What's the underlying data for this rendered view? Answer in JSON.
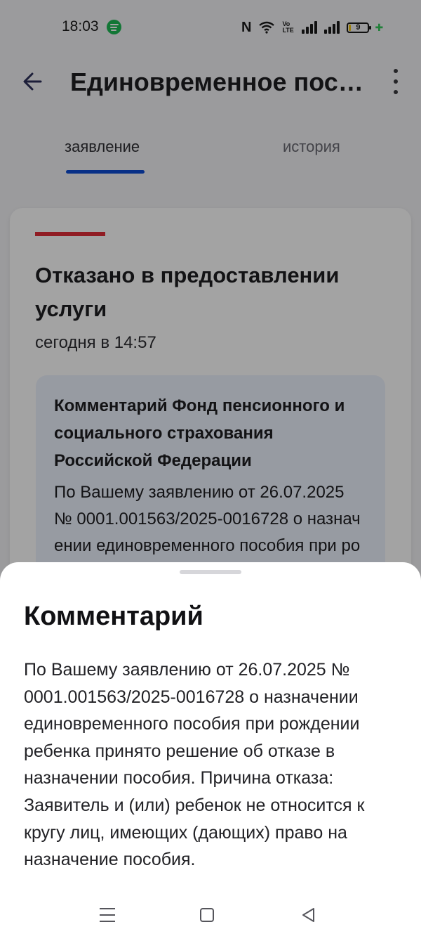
{
  "status_bar": {
    "time": "18:03",
    "nfc_label": "N",
    "volte_label": "Vo LTE",
    "battery_level": "9"
  },
  "header": {
    "title": "Единовременное пособие при рождении ребенка"
  },
  "tabs": [
    {
      "label": "заявление",
      "active": true
    },
    {
      "label": "история",
      "active": false
    }
  ],
  "status_card": {
    "title": "Отказано в предоставлении услуги",
    "time": "сегодня в 14:57",
    "comment_heading": "Комментарий Фонд пенсионного и социального страхования Российской Федерации",
    "comment_text": "По Вашему заявлению от 26.07.2025 № 0001.001563/2025-0016728 о назначении единовременного пособия при рождении ребенка принято решение об отказе в назначении пособия."
  },
  "sheet": {
    "title": "Комментарий",
    "text": "По Вашему заявлению от 26.07.2025 № 0001.001563/2025-0016728 о назначении единовременного пособия при рождении ребенка принято решение об отказе в назначении пособия. Причина отказа: Заявитель и (или) ребенок не относится к кругу лиц, имеющих (дающих) право на назначение пособия."
  },
  "colors": {
    "accent_blue": "#0d4cd3",
    "status_red": "#e22c38",
    "comment_bg": "#edf2fe",
    "scrim": "rgba(0,0,0,0.36)"
  },
  "icons": {
    "back": "arrow-left-icon",
    "menu": "kebab-menu-icon",
    "app": "spotify-icon",
    "nav_menu": "hamburger-icon",
    "nav_home": "square-home-icon",
    "nav_back": "triangle-back-icon"
  }
}
